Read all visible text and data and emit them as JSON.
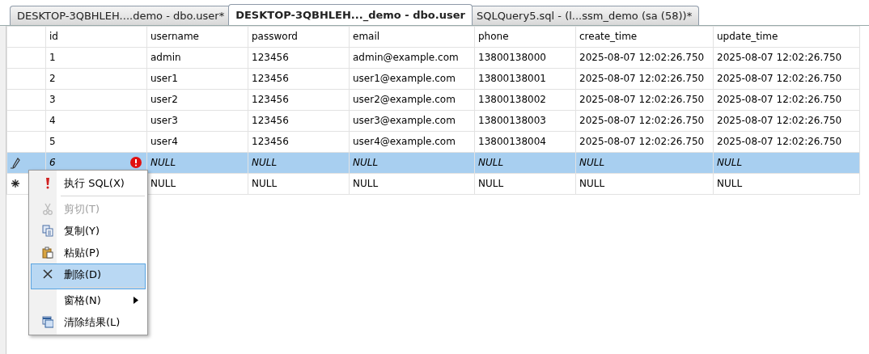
{
  "tabs": [
    {
      "label": "DESKTOP-3QBHLEH....demo - dbo.user*",
      "selected": false
    },
    {
      "label": "DESKTOP-3QBHLEH..._demo - dbo.user",
      "selected": true
    },
    {
      "label": "SQLQuery5.sql - (l...ssm_demo (sa (58))*",
      "selected": false
    }
  ],
  "table": {
    "columns": [
      "id",
      "username",
      "password",
      "email",
      "phone",
      "create_time",
      "update_time"
    ],
    "rows": [
      {
        "kind": "data",
        "selected": false,
        "error": false,
        "cells": [
          "1",
          "admin",
          "123456",
          "admin@example.com",
          "13800138000",
          "2025-08-07 12:02:26.750",
          "2025-08-07 12:02:26.750"
        ]
      },
      {
        "kind": "data",
        "selected": false,
        "error": false,
        "cells": [
          "2",
          "user1",
          "123456",
          "user1@example.com",
          "13800138001",
          "2025-08-07 12:02:26.750",
          "2025-08-07 12:02:26.750"
        ]
      },
      {
        "kind": "data",
        "selected": false,
        "error": false,
        "cells": [
          "3",
          "user2",
          "123456",
          "user2@example.com",
          "13800138002",
          "2025-08-07 12:02:26.750",
          "2025-08-07 12:02:26.750"
        ]
      },
      {
        "kind": "data",
        "selected": false,
        "error": false,
        "cells": [
          "4",
          "user3",
          "123456",
          "user3@example.com",
          "13800138003",
          "2025-08-07 12:02:26.750",
          "2025-08-07 12:02:26.750"
        ]
      },
      {
        "kind": "data",
        "selected": false,
        "error": false,
        "cells": [
          "5",
          "user4",
          "123456",
          "user4@example.com",
          "13800138004",
          "2025-08-07 12:02:26.750",
          "2025-08-07 12:02:26.750"
        ]
      },
      {
        "kind": "editing",
        "selected": true,
        "error": true,
        "cells": [
          "6",
          "NULL",
          "NULL",
          "NULL",
          "NULL",
          "NULL",
          "NULL"
        ]
      },
      {
        "kind": "new",
        "selected": false,
        "error": false,
        "cells": [
          "",
          "NULL",
          "NULL",
          "NULL",
          "NULL",
          "NULL",
          "NULL"
        ]
      }
    ]
  },
  "context_menu": [
    {
      "label": "执行 SQL(X)",
      "disabled": false,
      "selected": false,
      "submenu": false,
      "separator_after": true
    },
    {
      "label": "剪切(T)",
      "disabled": true,
      "selected": false,
      "submenu": false,
      "separator_after": false
    },
    {
      "label": "复制(Y)",
      "disabled": false,
      "selected": false,
      "submenu": false,
      "separator_after": false
    },
    {
      "label": "粘贴(P)",
      "disabled": false,
      "selected": false,
      "submenu": false,
      "separator_after": false
    },
    {
      "label": "删除(D)",
      "disabled": false,
      "selected": true,
      "submenu": false,
      "separator_after": true
    },
    {
      "label": "窗格(N)",
      "disabled": false,
      "selected": false,
      "submenu": true,
      "separator_after": false
    },
    {
      "label": "清除结果(L)",
      "disabled": false,
      "selected": false,
      "submenu": false,
      "separator_after": false
    }
  ]
}
